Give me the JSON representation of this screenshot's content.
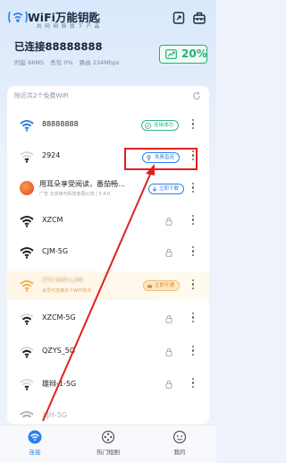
{
  "app": {
    "title": "WiFi万能钥匙",
    "subtitle": "尚 网 网 络 旗 下 产 品"
  },
  "header": {
    "icons": [
      "document-scan-icon",
      "toolbox-icon"
    ]
  },
  "status": {
    "title": "已连接88888888",
    "time_label": "时延 66MS",
    "loss_label": "丢包 0%",
    "router_label": "路由 234Mbps",
    "boost_percent": "20%"
  },
  "list": {
    "header": "附近共2个免费WiFi",
    "connected": {
      "ssid": "88888888",
      "button": "连接成功"
    },
    "free_network": {
      "ssid": "2924",
      "button": "免费直连"
    },
    "ad": {
      "title": "用耳朵享受阅读，番茄畅…",
      "sub": "广告 北京锋刊科技有限公司 | 5.4.0",
      "button": "立即下载"
    },
    "locked_before": [
      "XZCM",
      "CJM-5G"
    ],
    "promo": {
      "sub": "会员可连接多个WiFi热点",
      "button": "立即开通"
    },
    "locked_after": [
      "XZCM-5G",
      "QZYS_5G",
      "雄辩-1-5G",
      "XJH-5G"
    ]
  },
  "nav": {
    "items": [
      {
        "label": "连接",
        "active": true
      },
      {
        "label": "热门短剧",
        "active": false
      },
      {
        "label": "我的",
        "active": false
      }
    ]
  },
  "colors": {
    "accent": "#2d7fe6",
    "success": "#36b37e",
    "highlight": "#e02020",
    "gold": "#f0c070"
  }
}
